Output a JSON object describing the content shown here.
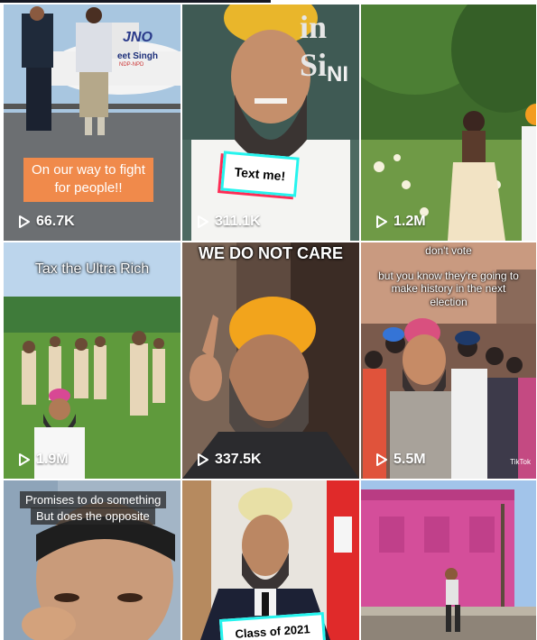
{
  "videos": [
    {
      "views": "66.7K",
      "caption": "On our way to fight for people!!",
      "sign": "eet Singh",
      "sign2": "NDP-NPD",
      "plane": "JNO"
    },
    {
      "views": "311.1K",
      "caption": "Text me!",
      "wall": "in Si",
      "wall2": "NI"
    },
    {
      "views": "1.2M"
    },
    {
      "views": "1.9M",
      "caption": "Tax the Ultra Rich"
    },
    {
      "views": "337.5K",
      "caption": "WE DO NOT CARE"
    },
    {
      "views": "5.5M",
      "caption_top": "don't vote",
      "caption": "but you know they're going to make history in the next election",
      "watermark": "TikTok"
    },
    {
      "caption_line1": "Promises to do something",
      "caption_line2": "But does the opposite"
    },
    {
      "caption": "Class of 2021"
    },
    {}
  ],
  "icons": {
    "play": "play-icon"
  }
}
